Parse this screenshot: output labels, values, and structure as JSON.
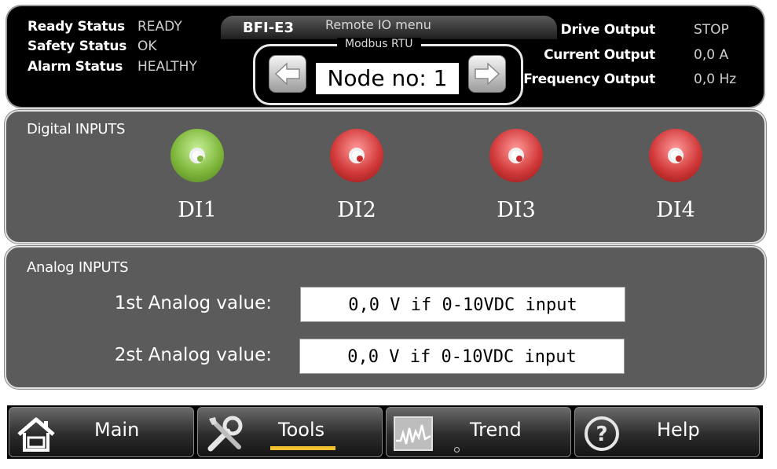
{
  "header": {
    "status": [
      {
        "label": "Ready Status",
        "value": "READY"
      },
      {
        "label": "Safety Status",
        "value": "OK"
      },
      {
        "label": "Alarm Status",
        "value": "HEALTHY"
      }
    ],
    "model": "BFI-E3",
    "menu_title": "Remote IO menu",
    "protocol": "Modbus RTU",
    "node_value": "Node no: 1",
    "outputs": [
      {
        "label": "Drive Output",
        "value": "STOP"
      },
      {
        "label": "Current Output",
        "value": "0,0 A"
      },
      {
        "label": "Frequency Output",
        "value": "0,0 Hz"
      }
    ]
  },
  "digital": {
    "title": "Digital INPUTS",
    "inputs": [
      {
        "label": "DI1",
        "state": "on",
        "color": "#7fb83c"
      },
      {
        "label": "DI2",
        "state": "off",
        "color": "#d23a3a"
      },
      {
        "label": "DI3",
        "state": "off",
        "color": "#d23a3a"
      },
      {
        "label": "DI4",
        "state": "off",
        "color": "#d23a3a"
      }
    ]
  },
  "analog": {
    "title": "Analog INPUTS",
    "rows": [
      {
        "label": "1st Analog value:",
        "value": "0,0 V if 0-10VDC input"
      },
      {
        "label": "2st Analog value:",
        "value": "0,0 V if 0-10VDC input"
      }
    ]
  },
  "nav": {
    "items": [
      {
        "label": "Main",
        "icon": "home-icon"
      },
      {
        "label": "Tools",
        "icon": "tools-icon",
        "active": true
      },
      {
        "label": "Trend",
        "icon": "trend-icon"
      },
      {
        "label": "Help",
        "icon": "help-icon"
      }
    ],
    "active_color": "#f2c12e"
  }
}
